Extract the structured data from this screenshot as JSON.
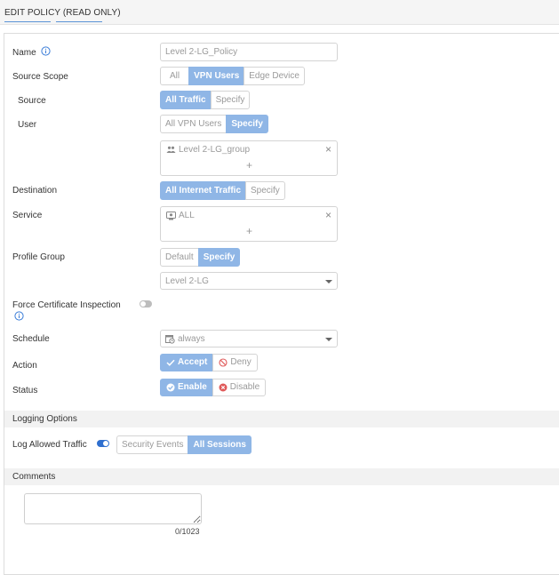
{
  "header": {
    "title": "EDIT POLICY (READ ONLY)"
  },
  "form": {
    "name": {
      "label": "Name",
      "value": "Level 2-LG_Policy"
    },
    "source_scope": {
      "label": "Source Scope",
      "options": [
        "All",
        "VPN Users",
        "Edge Device"
      ],
      "selected": "VPN Users"
    },
    "source": {
      "label": "Source",
      "options": [
        "All Traffic",
        "Specify"
      ],
      "selected": "All Traffic"
    },
    "user": {
      "label": "User",
      "options": [
        "All VPN Users",
        "Specify"
      ],
      "selected": "Specify",
      "tag": "Level 2-LG_group",
      "add": "+",
      "remove": "×"
    },
    "destination": {
      "label": "Destination",
      "options": [
        "All Internet Traffic",
        "Specify"
      ],
      "selected": "All Internet Traffic"
    },
    "service": {
      "label": "Service",
      "tag": "ALL",
      "add": "+",
      "remove": "×"
    },
    "profile_group": {
      "label": "Profile Group",
      "options": [
        "Default",
        "Specify"
      ],
      "selected": "Specify",
      "value": "Level 2-LG"
    },
    "force_cert": {
      "label": "Force Certificate Inspection",
      "enabled": false
    },
    "schedule": {
      "label": "Schedule",
      "value": "always"
    },
    "action": {
      "label": "Action",
      "accept": "Accept",
      "deny": "Deny",
      "selected": "Accept"
    },
    "status": {
      "label": "Status",
      "enable": "Enable",
      "disable": "Disable",
      "selected": "Enable"
    }
  },
  "logging": {
    "heading": "Logging Options",
    "label": "Log Allowed Traffic",
    "enabled": true,
    "options": [
      "Security Events",
      "All Sessions"
    ],
    "selected": "All Sessions"
  },
  "comments": {
    "heading": "Comments",
    "value": "",
    "counter": "0/1023"
  },
  "colors": {
    "accent": "#8fb6e6",
    "toggle_on": "#2f6fcf",
    "toggle_off": "#bdbdbd",
    "info": "#3b7dd8",
    "deny": "#e05a5a"
  }
}
